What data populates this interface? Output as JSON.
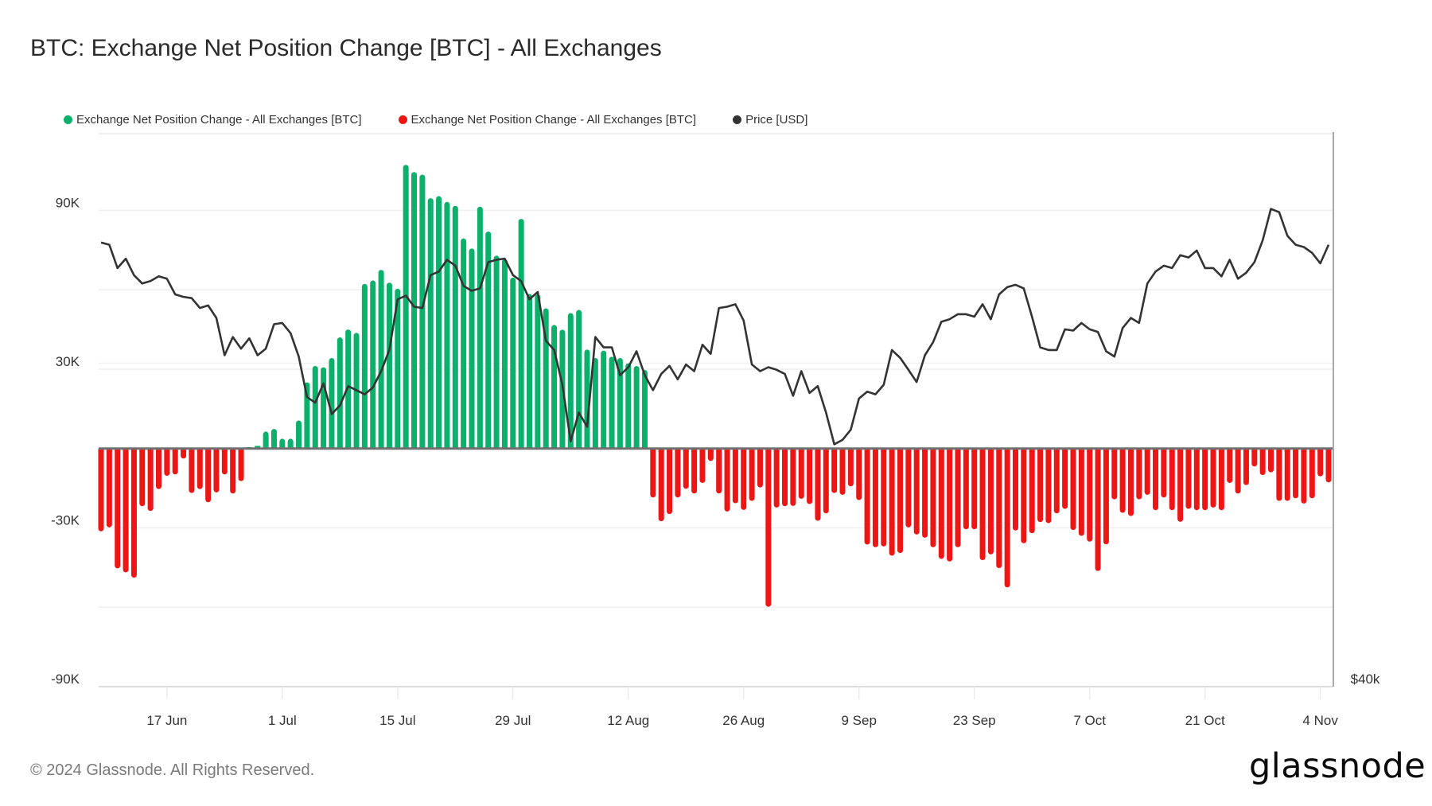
{
  "header": {
    "title": "BTC: Exchange Net Position Change [BTC] - All Exchanges"
  },
  "legend": [
    {
      "label": "Exchange Net Position Change - All Exchanges [BTC]",
      "color": "#0bb16b",
      "icon": "dot-icon"
    },
    {
      "label": "Exchange Net Position Change - All Exchanges [BTC]",
      "color": "#ee1515",
      "icon": "dot-icon"
    },
    {
      "label": "Price [USD]",
      "color": "#333333",
      "icon": "dot-icon"
    }
  ],
  "footer": {
    "copyright": "© 2024 Glassnode. All Rights Reserved.",
    "logo": "glassnode"
  },
  "chart_data": {
    "type": "bar",
    "title": "BTC: Exchange Net Position Change [BTC] - All Exchanges",
    "xlabel": "",
    "ylabel": "",
    "start_date": "2024-06-09",
    "end_date": "2024-11-04",
    "x_tick_labels": [
      {
        "label": "17 Jun",
        "date": "2024-06-17"
      },
      {
        "label": "1 Jul",
        "date": "2024-07-01"
      },
      {
        "label": "15 Jul",
        "date": "2024-07-15"
      },
      {
        "label": "29 Jul",
        "date": "2024-07-29"
      },
      {
        "label": "12 Aug",
        "date": "2024-08-12"
      },
      {
        "label": "26 Aug",
        "date": "2024-08-26"
      },
      {
        "label": "9 Sep",
        "date": "2024-09-09"
      },
      {
        "label": "23 Sep",
        "date": "2024-09-23"
      },
      {
        "label": "7 Oct",
        "date": "2024-10-07"
      },
      {
        "label": "21 Oct",
        "date": "2024-10-21"
      },
      {
        "label": "4 Nov",
        "date": "2024-11-04"
      }
    ],
    "y_left": {
      "unit": "BTC",
      "ylim": [
        -90000,
        119000
      ],
      "tick_labels": [
        {
          "label": "90K",
          "value": 90000
        },
        {
          "label": "30K",
          "value": 30000
        },
        {
          "label": "-30K",
          "value": -30000
        },
        {
          "label": "-90K",
          "value": -90000
        }
      ],
      "gridlines": [
        90000,
        60000,
        30000,
        -30000,
        -60000
      ]
    },
    "y_right": {
      "unit": "USD",
      "scale": "log",
      "ylim": [
        40000,
        80000
      ],
      "tick_labels": [
        {
          "label": "$40k",
          "value": 40000
        }
      ],
      "gridlines": [
        60000
      ]
    },
    "grid": true,
    "legend_position": "top-left",
    "series": [
      {
        "name": "Exchange Net Position Change - All Exchanges [BTC]",
        "kind": "bar",
        "unit": "K BTC",
        "positive_color": "#0bb16b",
        "negative_color": "#ee1515",
        "values": [
          -31.3,
          -29.8,
          -45.3,
          -46.8,
          -48.8,
          -21.8,
          -23.6,
          -15.3,
          -10.3,
          -9.8,
          -3.8,
          -16.8,
          -15.3,
          -20.3,
          -16.6,
          -9.8,
          -17.0,
          -12.3,
          0.5,
          1.0,
          6.4,
          7.4,
          3.7,
          3.7,
          10.6,
          25.0,
          31.2,
          30.7,
          34.2,
          42.0,
          45.0,
          43.7,
          62.2,
          63.5,
          67.5,
          62.7,
          60.4,
          107.2,
          104.5,
          103.5,
          94.6,
          95.4,
          93.2,
          91.7,
          79.4,
          75.6,
          91.4,
          82.0,
          72.9,
          71.6,
          64.6,
          86.8,
          58.4,
          58.2,
          53.0,
          46.7,
          44.9,
          51.2,
          52.4,
          37.4,
          34.2,
          37.0,
          34.7,
          34.2,
          32.2,
          31.2,
          29.7,
          -18.5,
          -27.5,
          -24.8,
          -18.5,
          -15.2,
          -17.0,
          -13.0,
          -4.7,
          -17.0,
          -23.8,
          -20.7,
          -23.2,
          -19.8,
          -14.7,
          -59.8,
          -22.3,
          -21.8,
          -21.7,
          -19.0,
          -21.0,
          -27.3,
          -24.5,
          -16.8,
          -17.5,
          -14.3,
          -19.5,
          -36.3,
          -37.3,
          -37.0,
          -40.5,
          -39.5,
          -29.8,
          -32.5,
          -33.7,
          -37.3,
          -41.7,
          -42.7,
          -37.3,
          -30.5,
          -30.5,
          -42.2,
          -40.0,
          -45.2,
          -52.5,
          -31.0,
          -35.8,
          -32.0,
          -27.8,
          -28.2,
          -24.5,
          -22.8,
          -30.8,
          -33.0,
          -35.2,
          -46.3,
          -36.2,
          -19.2,
          -24.3,
          -25.5,
          -19.2,
          -17.5,
          -23.3,
          -18.5,
          -23.3,
          -27.7,
          -22.8,
          -23.3,
          -23.3,
          -22.3,
          -23.3,
          -13.0,
          -17.0,
          -13.8,
          -6.8,
          -10.0,
          -9.0,
          -19.8,
          -19.8,
          -18.8,
          -20.8,
          -18.8,
          -10.5,
          -12.8
        ]
      },
      {
        "name": "Price [USD]",
        "kind": "line",
        "unit": "K USD",
        "color": "#333333",
        "values": [
          69.8,
          69.6,
          67.6,
          68.4,
          67.0,
          66.3,
          66.5,
          66.9,
          66.7,
          65.4,
          65.2,
          65.1,
          64.3,
          64.5,
          63.5,
          60.6,
          62.0,
          61.1,
          61.9,
          60.6,
          61.1,
          63.0,
          63.1,
          62.3,
          60.5,
          57.5,
          57.1,
          58.5,
          56.3,
          56.9,
          58.3,
          58.0,
          57.7,
          58.2,
          59.4,
          61.0,
          65.0,
          65.3,
          64.4,
          64.3,
          67.0,
          67.3,
          68.3,
          67.8,
          66.1,
          65.7,
          65.9,
          68.1,
          68.3,
          68.4,
          67.0,
          66.5,
          65.0,
          65.6,
          61.7,
          61.0,
          58.4,
          54.4,
          56.4,
          55.4,
          62.0,
          61.2,
          61.2,
          59.1,
          59.7,
          60.9,
          59.1,
          58.0,
          59.2,
          59.8,
          58.8,
          59.9,
          59.4,
          61.4,
          60.7,
          64.3,
          64.4,
          64.6,
          63.3,
          59.9,
          59.4,
          59.7,
          59.5,
          59.2,
          57.6,
          59.4,
          57.8,
          58.3,
          56.4,
          54.2,
          54.5,
          55.2,
          57.4,
          57.9,
          57.7,
          58.4,
          61.0,
          60.4,
          59.5,
          58.6,
          60.6,
          61.6,
          63.2,
          63.4,
          63.8,
          63.8,
          63.6,
          64.6,
          63.4,
          65.4,
          66.0,
          66.2,
          65.9,
          63.6,
          61.2,
          61.0,
          61.0,
          62.6,
          62.5,
          63.1,
          62.6,
          62.4,
          60.9,
          60.5,
          62.7,
          63.5,
          63.1,
          66.3,
          67.3,
          67.8,
          67.6,
          68.7,
          68.5,
          69.1,
          67.6,
          67.6,
          66.9,
          68.3,
          66.7,
          67.2,
          68.1,
          70.0,
          72.8,
          72.5,
          70.4,
          69.6,
          69.4,
          68.9,
          68.0,
          69.6
        ]
      }
    ]
  }
}
